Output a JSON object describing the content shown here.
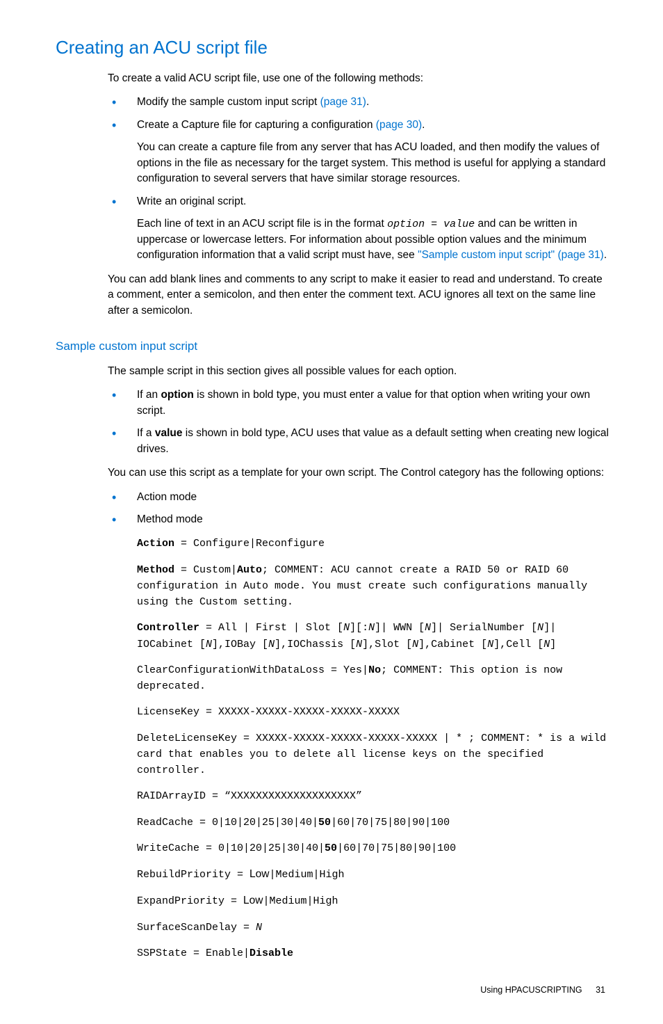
{
  "heading1": "Creating an ACU script file",
  "intro": "To create a valid ACU script file, use one of the following methods:",
  "methods": {
    "item1": {
      "text_pre": "Modify the sample custom input script ",
      "link": "(page 31)",
      "text_post": "."
    },
    "item2": {
      "text_pre": "Create a Capture file for capturing a configuration ",
      "link": "(page 30)",
      "text_post": ".",
      "detail": "You can create a capture file from any server that has ACU loaded, and then modify the values of options in the file as necessary for the target system. This method is useful for applying a standard configuration to several servers that have similar storage resources."
    },
    "item3": {
      "text": "Write an original script.",
      "detail_pre": "Each line of text in an ACU script file is in the format ",
      "detail_code": "option = value",
      "detail_mid": " and can be written in uppercase or lowercase letters. For information about possible option values and the minimum configuration information that a valid script must have, see ",
      "detail_link": "\"Sample custom input script\" (page 31)",
      "detail_post": "."
    }
  },
  "para1": "You can add blank lines and comments to any script to make it easier to read and understand. To create a comment, enter a semicolon, and then enter the comment text. ACU ignores all text on the same line after a semicolon.",
  "heading2": "Sample custom input script",
  "sample_intro": "The sample script in this section gives all possible values for each option.",
  "rules": {
    "item1": {
      "pre": "If an ",
      "bold": "option",
      "post": " is shown in bold type, you must enter a value for that option when writing your own script."
    },
    "item2": {
      "pre": "If a ",
      "bold": "value",
      "post": " is shown in bold type, ACU uses that value as a default setting when creating new logical drives."
    }
  },
  "para2": "You can use this script as a template for your own script. The Control category has the following options:",
  "modes": {
    "item1": "Action mode",
    "item2": "Method mode"
  },
  "code": {
    "action": {
      "key": "Action",
      "rest": " = Configure|Reconfigure"
    },
    "method": {
      "key": "Method",
      "mid": " = Custom|",
      "auto": "Auto",
      "rest": "; COMMENT: ACU cannot create a RAID 50 or RAID 60 configuration in Auto mode. You must create such configurations manually using the Custom setting."
    },
    "controller": {
      "key": "Controller",
      "mid": " = All | First | Slot [",
      "n1": "N",
      "b1": "][:",
      "n2": "N",
      "b2": "]| WWN [",
      "n3": "N",
      "b3": "]| SerialNumber [",
      "n4": "N",
      "b4": "]| IOCabinet [",
      "n5": "N",
      "b5": "],IOBay [",
      "n6": "N",
      "b6": "],IOChassis [",
      "n7": "N",
      "b7": "],Slot [",
      "n8": "N",
      "b8": "],Cabinet [",
      "n9": "N",
      "b9": "],Cell [",
      "n10": "N",
      "b10": "]"
    },
    "clearcfg": {
      "pre": "ClearConfigurationWithDataLoss = Yes|",
      "no": "No",
      "post": "; COMMENT: This option is now deprecated."
    },
    "licensekey": "LicenseKey = XXXXX-XXXXX-XXXXX-XXXXX-XXXXX",
    "deletelic": "DeleteLicenseKey = XXXXX-XXXXX-XXXXX-XXXXX-XXXXX | * ; COMMENT: * is a wild card that enables you to delete all license keys on the specified controller.",
    "raidarray": "RAIDArrayID = “XXXXXXXXXXXXXXXXXXXX”",
    "readcache": {
      "pre": "ReadCache = 0|10|20|25|30|40|",
      "bold": "50",
      "post": "|60|70|75|80|90|100"
    },
    "writecache": {
      "pre": "WriteCache = 0|10|20|25|30|40|",
      "bold": "50",
      "post": "|60|70|75|80|90|100"
    },
    "rebuild": {
      "pre": "RebuildPriority = ",
      "low": "Low",
      "post": "|Medium|High"
    },
    "expand": {
      "pre": "ExpandPriority = ",
      "low": "Low",
      "post": "|Medium|High"
    },
    "surface": {
      "pre": "SurfaceScanDelay = ",
      "n": "N"
    },
    "sspstate": {
      "pre": "SSPState = Enable|",
      "bold": "Disable"
    }
  },
  "footer": {
    "text": "Using HPACUSCRIPTING",
    "page": "31"
  }
}
